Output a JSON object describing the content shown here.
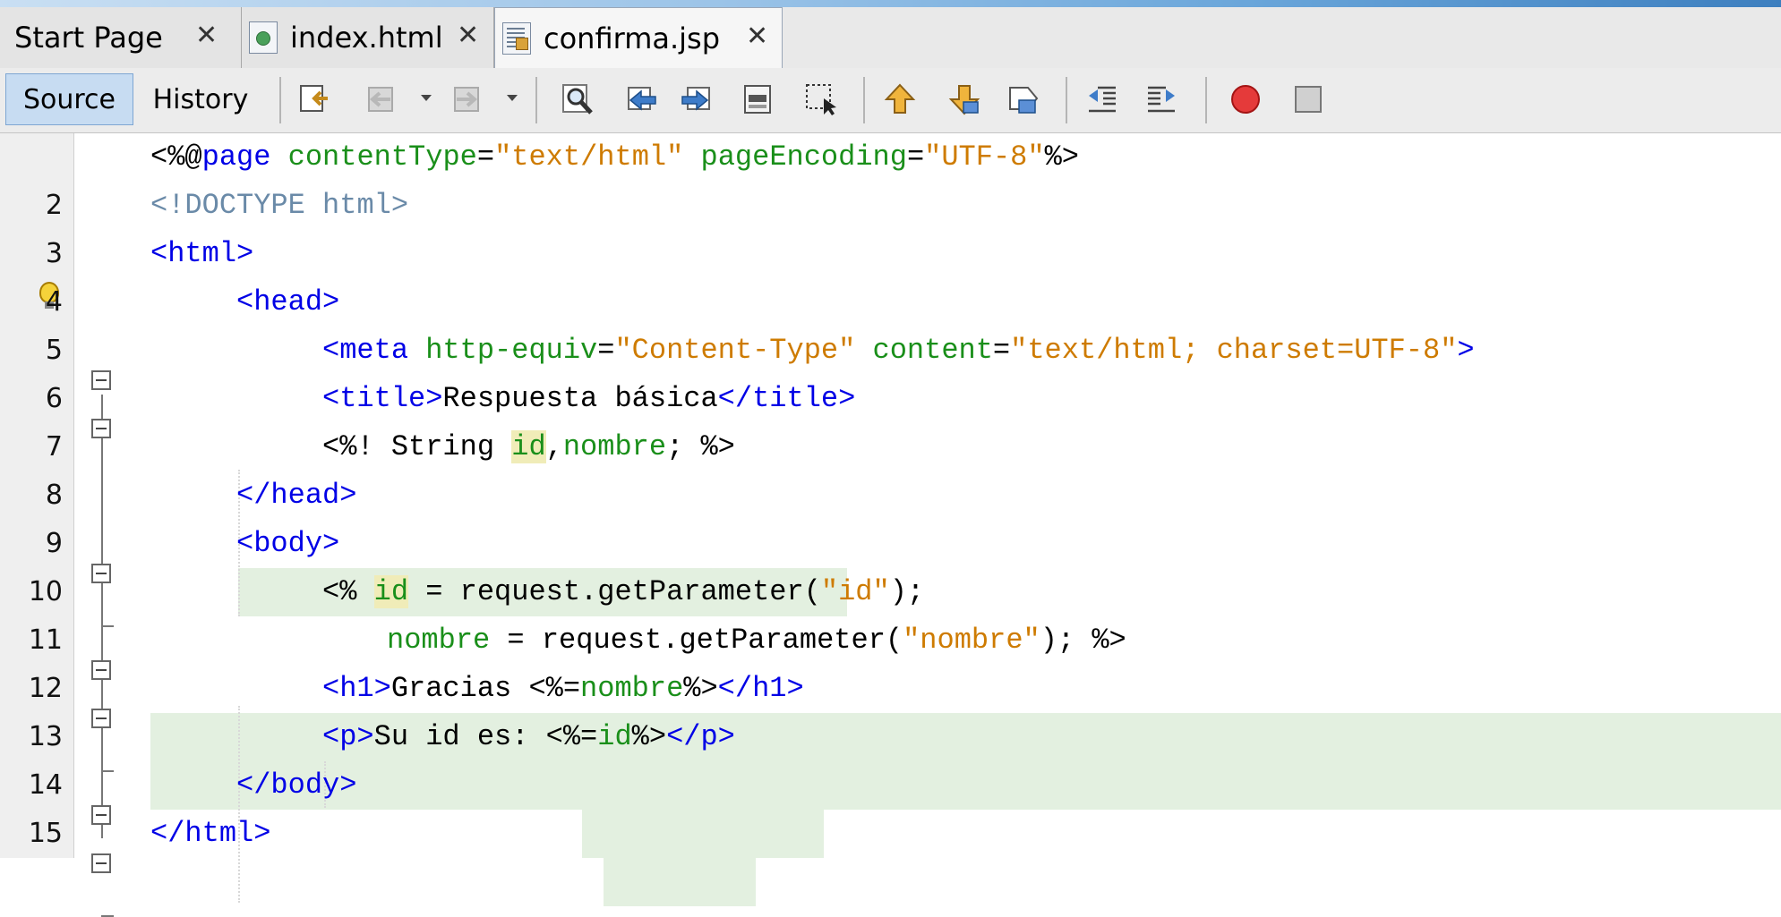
{
  "tabs": [
    {
      "label": "Start Page",
      "close": "✕",
      "icon": "none",
      "active": false
    },
    {
      "label": "index.html",
      "close": "✕",
      "icon": "html-file-icon",
      "active": false
    },
    {
      "label": "confirma.jsp",
      "close": "✕",
      "icon": "jsp-file-icon",
      "active": true
    }
  ],
  "toolbar": {
    "source_label": "Source",
    "history_label": "History",
    "active_mode": "Source",
    "icons": [
      "last-edit-icon",
      "back-icon",
      "forward-icon",
      "find-icon",
      "find-previous-icon",
      "find-next-icon",
      "find-selection-icon",
      "toggle-highlight-icon",
      "previous-bookmark-icon",
      "next-bookmark-icon",
      "toggle-bookmark-icon",
      "shift-left-icon",
      "shift-right-icon",
      "start-macro-icon",
      "stop-macro-icon"
    ]
  },
  "editor": {
    "file": "confirma.jsp",
    "line_numbers": [
      "",
      "2",
      "3",
      "4",
      "5",
      "6",
      "7",
      "8",
      "9",
      "10",
      "11",
      "12",
      "13",
      "14",
      "15"
    ],
    "colors": {
      "tag": "#0000e6",
      "attribute": "#1a8f1a",
      "string": "#ce7b00",
      "comment": "#6a8aa8",
      "jsp_highlight": "#e3f0e0",
      "occurrence": "#f0ecb8"
    }
  },
  "code": {
    "l1": {
      "open": "<%@",
      "kw": "page",
      "a1": " contentType",
      "eq1": "=",
      "v1": "\"text/html\"",
      "a2": " pageEncoding",
      "eq2": "=",
      "v2": "\"UTF-8\"",
      "close": "%>"
    },
    "l2": {
      "text": "<!DOCTYPE html>"
    },
    "l3": {
      "text": "<html>"
    },
    "l4": {
      "text": "<head>"
    },
    "l5": {
      "open": "<meta",
      "a1": " http-equiv",
      "eq1": "=",
      "v1": "\"Content-Type\"",
      "a2": " content",
      "eq2": "=",
      "v2": "\"text/html; charset=UTF-8\"",
      "close": ">"
    },
    "l6": {
      "open": "<title>",
      "body": "Respuesta básica",
      "close": "</title>"
    },
    "l7": {
      "a": "<%! String ",
      "id": "id",
      "b": ",",
      "nombre": "nombre",
      "c": "; %>"
    },
    "l8": {
      "text": "</head>"
    },
    "l9": {
      "text": "<body>"
    },
    "l10": {
      "a": "<% ",
      "id": "id",
      "b": " = request.getParameter(",
      "s": "\"id\"",
      "c": ");"
    },
    "l11": {
      "nombre": "nombre",
      "b": " = request.getParameter(",
      "s": "\"nombre\"",
      "c": "); %>"
    },
    "l12": {
      "open": "<h1>",
      "body": "Gracias ",
      "jo": "<%=",
      "var": "nombre",
      "jc": "%>",
      "close": "</h1>"
    },
    "l13": {
      "open": "<p>",
      "body": "Su id es: ",
      "jo": "<%=",
      "var": "id",
      "jc": "%>",
      "close": "</p>"
    },
    "l14": {
      "text": "</body>"
    },
    "l15": {
      "text": "</html>"
    }
  }
}
